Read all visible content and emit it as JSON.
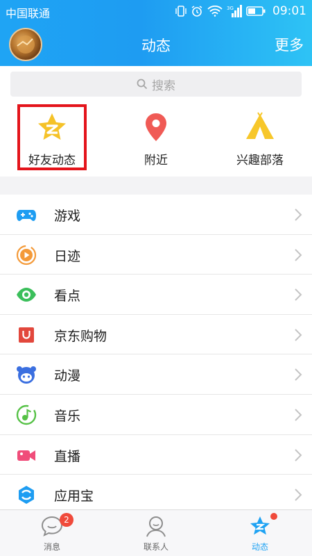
{
  "status_bar": {
    "carrier": "中国联通",
    "time": "09:01",
    "network": "3G"
  },
  "header": {
    "title": "动态",
    "more_label": "更多"
  },
  "search": {
    "placeholder": "搜索"
  },
  "quick_entries": [
    {
      "label": "好友动态",
      "icon": "qzone-star-icon",
      "color": "#f5c228",
      "highlighted": true
    },
    {
      "label": "附近",
      "icon": "location-pin-icon",
      "color": "#f05a55",
      "highlighted": false
    },
    {
      "label": "兴趣部落",
      "icon": "tent-icon",
      "color": "#f7c72a",
      "highlighted": false
    }
  ],
  "list": [
    {
      "label": "游戏",
      "icon": "gamepad-icon",
      "color": "#1e9df2"
    },
    {
      "label": "日迹",
      "icon": "play-circle-icon",
      "color": "#f49a39"
    },
    {
      "label": "看点",
      "icon": "eye-icon",
      "color": "#3bbf5b"
    },
    {
      "label": "京东购物",
      "icon": "jd-bag-icon",
      "color": "#e2473c"
    },
    {
      "label": "动漫",
      "icon": "anime-face-icon",
      "color": "#3b6fe0"
    },
    {
      "label": "音乐",
      "icon": "music-note-icon",
      "color": "#55c145"
    },
    {
      "label": "直播",
      "icon": "video-camera-icon",
      "color": "#f04d7a"
    },
    {
      "label": "应用宝",
      "icon": "app-store-icon",
      "color": "#1e9df2"
    }
  ],
  "tabs": [
    {
      "label": "消息",
      "icon": "chat-bubble-icon",
      "badge": "2",
      "active": false
    },
    {
      "label": "联系人",
      "icon": "contact-person-icon",
      "badge": "",
      "active": false
    },
    {
      "label": "动态",
      "icon": "dynamic-star-icon",
      "badge": "",
      "active": true
    }
  ],
  "colors": {
    "accent": "#1ea2f3",
    "highlight_box": "#e4141b",
    "badge": "#f04a3b"
  }
}
